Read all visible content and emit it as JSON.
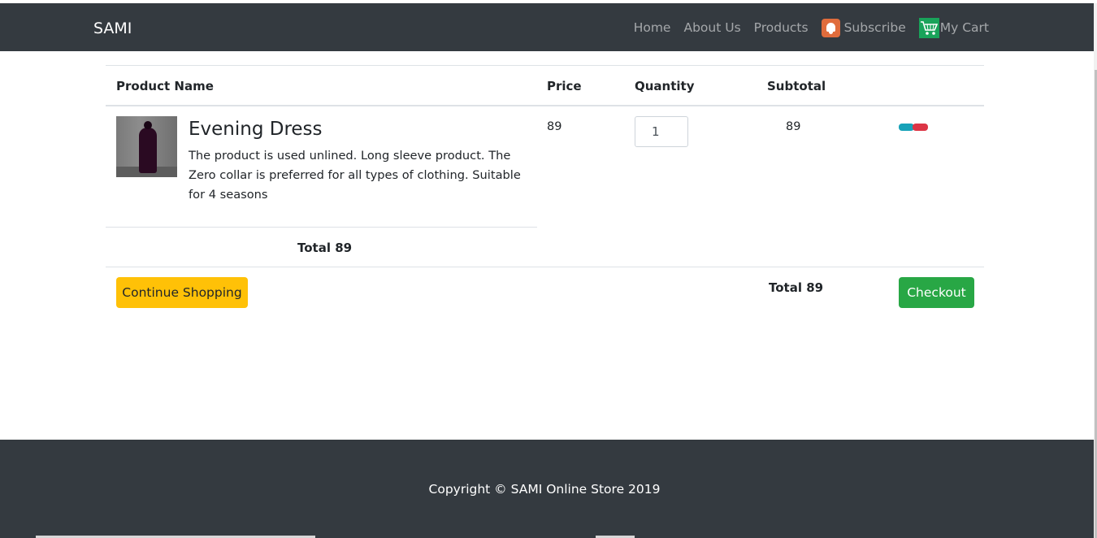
{
  "brand": "SAMI",
  "nav": {
    "home": "Home",
    "about": "About Us",
    "products": "Products",
    "subscribe": "Subscribe",
    "cart": "My Cart"
  },
  "table": {
    "headers": {
      "product": "Product Name",
      "price": "Price",
      "quantity": "Quantity",
      "subtotal": "Subtotal"
    },
    "rows": [
      {
        "name": "Evening Dress",
        "description": "The product is used unlined. Long sleeve product. The Zero collar is preferred for all types of clothing. Suitable for 4 seasons",
        "price": "89",
        "quantity": "1",
        "subtotal": "89"
      }
    ],
    "total_row_label": "Total 89"
  },
  "actions": {
    "continue_label": "Continue Shopping",
    "total_label": "Total 89",
    "checkout_label": "Checkout"
  },
  "footer": {
    "copyright": "Copyright © SAMI Online Store 2019"
  },
  "colors": {
    "navbar": "#343a40",
    "warning": "#ffc107",
    "success": "#28a745",
    "info": "#17a2b8",
    "danger": "#dc3545"
  },
  "icons": {
    "subscribe": "bell-icon",
    "cart": "cart-icon",
    "update": "refresh-icon",
    "remove": "trash-icon"
  }
}
